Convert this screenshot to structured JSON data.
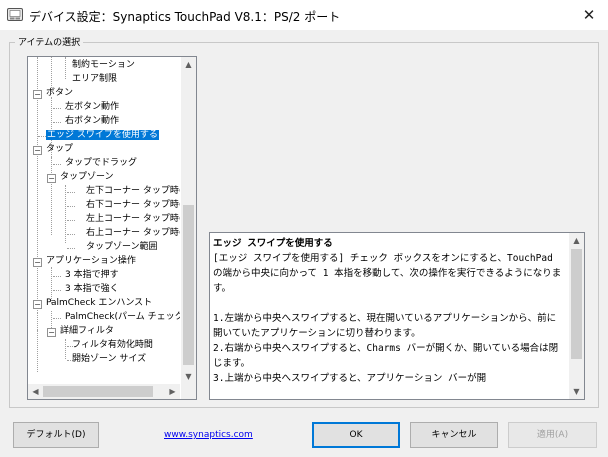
{
  "window": {
    "title": "デバイス設定：Synaptics TouchPad V8.1：PS/2 ポート",
    "close_glyph": "✕"
  },
  "group": {
    "label": "アイテムの選択"
  },
  "tree": {
    "items": [
      {
        "label": "制約モーション"
      },
      {
        "label": "エリア制限"
      },
      {
        "label": "ボタン",
        "toggle": "−"
      },
      {
        "label": "左ボタン動作"
      },
      {
        "label": "右ボタン動作"
      },
      {
        "label": "エッジ スワイプを使用する",
        "selected": true
      },
      {
        "label": "タップ",
        "toggle": "−"
      },
      {
        "label": "タップでドラッグ"
      },
      {
        "label": "タップゾーン",
        "toggle": "−"
      },
      {
        "label": "左下コーナー タップ時の"
      },
      {
        "label": "右下コーナー タップ時の"
      },
      {
        "label": "左上コーナー タップ時の"
      },
      {
        "label": "右上コーナー タップ時の"
      },
      {
        "label": "タップゾーン範囲"
      },
      {
        "label": "アプリケーション操作",
        "toggle": "−"
      },
      {
        "label": "3 本指で押す"
      },
      {
        "label": "3 本指で強く"
      },
      {
        "label": "PalmCheck エンハンスト",
        "toggle": "−"
      },
      {
        "label": "PalmCheck(パーム チェック)"
      },
      {
        "label": "詳細フィルタ",
        "toggle": "−"
      },
      {
        "label": "フィルタ有効化時間"
      },
      {
        "label": "開始ゾーン サイズ"
      }
    ]
  },
  "description": {
    "title": "エッジ スワイプを使用する",
    "body": "[エッジ スワイプを使用する] チェック ボックスをオンにすると、TouchPad の端から中央に向かって 1 本指を移動して、次の操作を実行できるようになります。\n\n1.左端から中央へスワイプすると、現在開いているアプリケーションから、前に開いていたアプリケーションに切り替わります。\n2.右端から中央へスワイプすると、Charms バーが開くか、開いている場合は閉じます。\n3.上端から中央へスワイプすると、アプリケーション バーが開"
  },
  "footer": {
    "default_button": "デフォルト(D)",
    "link": "www.synaptics.com",
    "ok_button": "OK",
    "cancel_button": "キャンセル",
    "apply_button": "適用(A)"
  },
  "scroll": {
    "up": "▲",
    "down": "▼",
    "left": "◀",
    "right": "▶"
  },
  "colors": {
    "selection": "#0078d7",
    "link": "#0000ee"
  }
}
